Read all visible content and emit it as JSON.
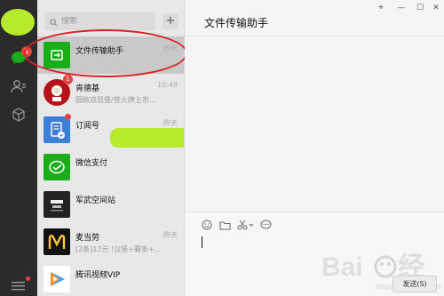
{
  "search": {
    "placeholder": "搜索",
    "add_label": "+"
  },
  "rail": {
    "chat_badge": "1"
  },
  "chats": [
    {
      "name": "文件传输助手",
      "preview": "",
      "time": "昨天",
      "badge": "",
      "thumb_color": "#1aad19",
      "thumb_icon": "file-transfer-icon"
    },
    {
      "name": "肯德基",
      "preview": "圆椒双层堡/誉火牌上市...",
      "time": "10:49",
      "badge": "1",
      "thumb_color": "#b5121b",
      "thumb_icon": "kfc-logo"
    },
    {
      "name": "订阅号",
      "preview": "",
      "time": "昨天",
      "badge": "dot",
      "thumb_color": "#3d7fd6",
      "thumb_icon": "subscription-icon"
    },
    {
      "name": "微信支付",
      "preview": "",
      "time": "",
      "badge": "",
      "thumb_color": "#1aad19",
      "thumb_icon": "wechat-pay-icon"
    },
    {
      "name": "军武空间站",
      "preview": "",
      "time": "",
      "badge": "",
      "thumb_color": "#222222",
      "thumb_icon": "military-logo"
    },
    {
      "name": "麦当劳",
      "preview": "[2条]17元 !汉堡+賽条+...",
      "time": "昨天",
      "badge": "",
      "thumb_color": "#111111",
      "thumb_icon": "mcdonalds-logo"
    },
    {
      "name": "腾讯视频VIP",
      "preview": "",
      "time": "",
      "badge": "",
      "thumb_color": "#ffffff",
      "thumb_icon": "tencent-video-icon"
    }
  ],
  "main": {
    "title": "文件传输助手",
    "window_controls": [
      "⌖",
      "—",
      "☐",
      "✕"
    ],
    "send_label": "发送(S)"
  },
  "watermark": {
    "url": "jingyan.baidu.com"
  },
  "colors": {
    "accent_green": "#1aad19",
    "badge_red": "#e64340",
    "annotation_red": "#d9232a",
    "smear_green": "#b7ea2a"
  }
}
